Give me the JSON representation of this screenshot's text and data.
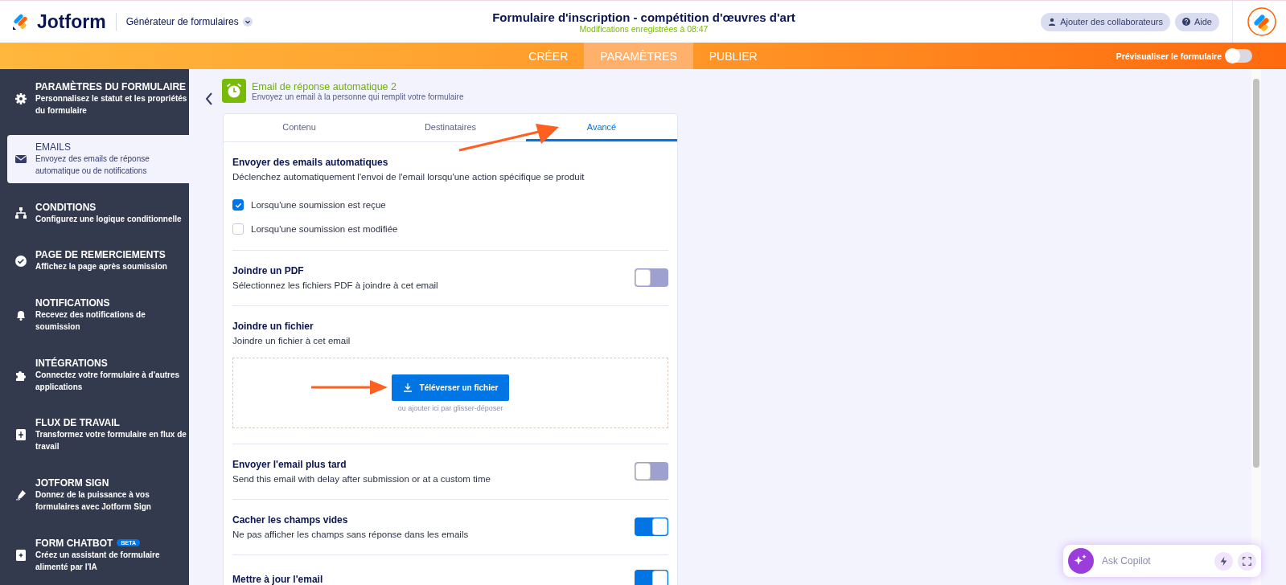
{
  "header": {
    "brand": "Jotform",
    "builder_menu": "Générateur de formulaires",
    "title": "Formulaire d'inscription - compétition d'œuvres d'art",
    "save_status": "Modifications enregistrées à 08:47",
    "buttons": [
      {
        "kind": "user",
        "label": "Ajouter des collaborateurs"
      },
      {
        "kind": "help",
        "label": "Aide"
      }
    ]
  },
  "nav": {
    "tabs": [
      {
        "label": "CRÉER",
        "selected": false
      },
      {
        "label": "PARAMÈTRES",
        "selected": true
      },
      {
        "label": "PUBLIER",
        "selected": false
      }
    ],
    "preview": {
      "label": "Prévisualiser le formulaire",
      "on": false
    }
  },
  "sidebar": {
    "items": [
      {
        "title": "PARAMÈTRES DU FORMULAIRE",
        "description": "Personnalisez le statut et les propriétés du formulaire",
        "selected": false
      },
      {
        "title": "EMAILS",
        "description": "Envoyez des emails de réponse automatique ou de notifications",
        "selected": true
      },
      {
        "title": "CONDITIONS",
        "description": "Configurez une logique conditionnelle",
        "selected": false
      },
      {
        "title": "PAGE DE REMERCIEMENTS",
        "description": "Affichez la page après soumission",
        "selected": false
      },
      {
        "title": "NOTIFICATIONS",
        "description": "Recevez des notifications de soumission",
        "selected": false
      },
      {
        "title": "INTÉGRATIONS",
        "description": "Connectez votre formulaire à d'autres applications",
        "selected": false
      },
      {
        "title": "FLUX DE TRAVAIL",
        "description": "Transformez votre formulaire en flux de travail",
        "selected": false
      },
      {
        "title": "JOTFORM SIGN",
        "description": "Donnez de la puissance à vos formulaires avec Jotform Sign",
        "selected": false
      },
      {
        "title": "FORM CHATBOT",
        "badge": "BETA",
        "description": "Créez un assistant de formulaire alimenté par l'IA",
        "selected": false
      }
    ]
  },
  "email": {
    "title": "Email de réponse automatique 2",
    "subtitle": "Envoyez un email à la personne qui remplit votre formulaire"
  },
  "tabs": [
    {
      "label": "Contenu",
      "selected": false
    },
    {
      "label": "Destinataires",
      "selected": false
    },
    {
      "label": "Avancé",
      "selected": true
    }
  ],
  "sections": [
    {
      "kind": "checkboxes",
      "title": "Envoyer des emails automatiques",
      "description": "Déclenchez automatiquement l'envoi de l'email lorsqu'une action spécifique se produit",
      "options": [
        {
          "label": "Lorsqu'une soumission est reçue",
          "checked": true
        },
        {
          "label": "Lorsqu'une soumission est modifiée",
          "checked": false
        }
      ]
    },
    {
      "kind": "toggle",
      "title": "Joindre un PDF",
      "description": "Sélectionnez les fichiers PDF à joindre à cet email",
      "on": false
    },
    {
      "kind": "upload",
      "title": "Joindre un fichier",
      "description": "Joindre un fichier à cet email",
      "button": "Téléverser un fichier",
      "hint": "ou ajouter ici par glisser-déposer"
    },
    {
      "kind": "toggle",
      "title": "Envoyer l'email plus tard",
      "description": "Send this email with delay after submission or at a custom time",
      "on": false
    },
    {
      "kind": "toggle",
      "title": "Cacher les champs vides",
      "description": "Ne pas afficher les champs sans réponse dans les emails",
      "on": true
    },
    {
      "kind": "toggle",
      "title": "Mettre à jour l'email",
      "on": true
    }
  ],
  "copilot": {
    "placeholder": "Ask Copilot"
  }
}
